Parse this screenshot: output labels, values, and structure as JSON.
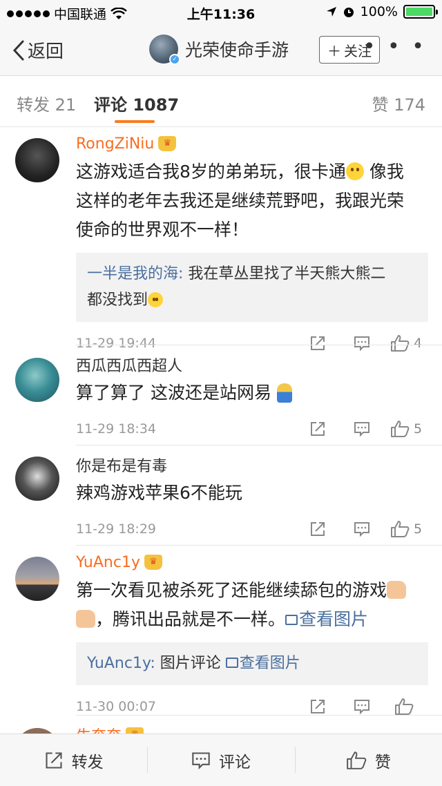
{
  "status": {
    "carrier": "中国联通",
    "time": "上午11:36",
    "battery": "100%",
    "battery_level": 1.0,
    "battery_color": "#4cd964"
  },
  "nav": {
    "back_label": "返回",
    "title": "光荣使命手游",
    "follow_label": "关注",
    "more_label": "• • •"
  },
  "tabs": {
    "repost_label": "转发",
    "repost_count": "21",
    "comment_label": "评论",
    "comment_count": "1087",
    "like_label": "赞",
    "like_count": "174",
    "accent_color": "#f77c1e"
  },
  "comments": [
    {
      "name": "RongZiNiu",
      "vip": true,
      "text_line1": "这游戏适合我8岁的弟弟玩，很卡通",
      "text_line1b": " 像我",
      "text_line2": "这样的老年去我还是继续荒野吧，我跟光荣",
      "text_line3": "使命的世界观不一样！",
      "reply_name": "一半是我的海:",
      "reply_text": " 我在草丛里找了半天熊大熊二",
      "reply_text2": "都没找到",
      "time": "11-29 19:44",
      "likes": "4"
    },
    {
      "name": "西瓜西瓜西超人",
      "vip": false,
      "text": "算了算了 这波还是站网易",
      "time": "11-29 18:34",
      "likes": "5"
    },
    {
      "name": "你是布是有毒",
      "vip": false,
      "text": "辣鸡游戏苹果6不能玩",
      "time": "11-29 18:29",
      "likes": "5"
    },
    {
      "name": "YuAnc1y",
      "vip": true,
      "text_line1": "第一次看见被杀死了还能继续舔包的游戏",
      "text_line2": "，腾讯出品就是不一样。",
      "view_image": "查看图片",
      "reply_name": "YuAnc1y:",
      "reply_text": " 图片评论 ",
      "reply_view_image": "查看图片",
      "time": "11-30 00:07",
      "likes": ""
    }
  ],
  "partial_next_name": "牛奔奔",
  "bottom": {
    "repost": "转发",
    "comment": "评论",
    "like": "赞"
  },
  "icons": {
    "share": "share-icon",
    "comment": "comment-icon",
    "like": "thumbs-up-icon",
    "back": "chevron-left-icon",
    "signal": "wifi-icon",
    "location": "location-icon",
    "alarm": "alarm-icon"
  }
}
